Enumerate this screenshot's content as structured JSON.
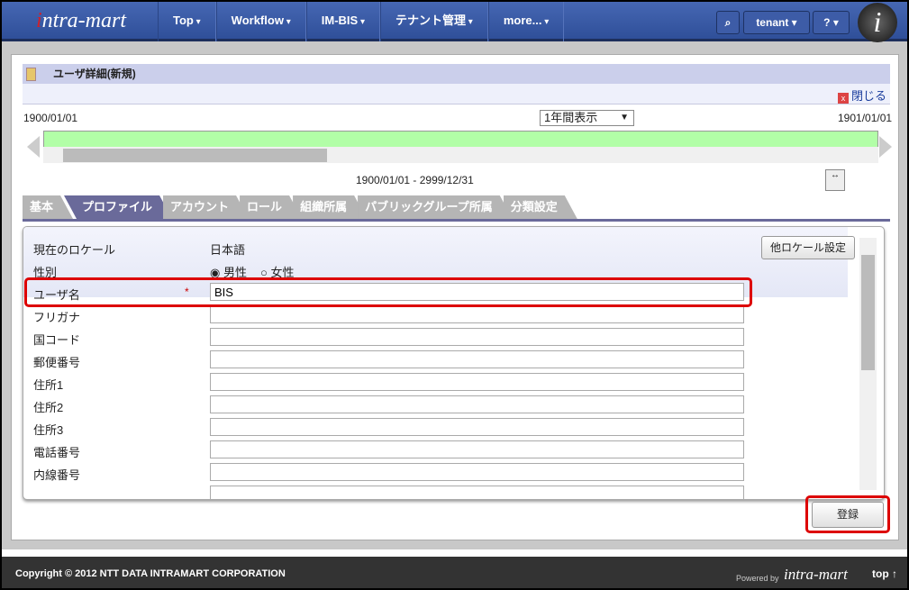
{
  "header": {
    "logo": "intra-mart",
    "nav": [
      "Top",
      "Workflow",
      "IM-BIS",
      "テナント管理",
      "more..."
    ],
    "user": "tenant",
    "help": "?"
  },
  "page": {
    "title": "ユーザ詳細(新規)",
    "close": "閉じる",
    "start_date": "1900/01/01",
    "end_date": "1901/01/01",
    "period_select": "1年間表示",
    "range": "1900/01/01 - 2999/12/31"
  },
  "tabs": [
    "基本",
    "プロファイル",
    "アカウント",
    "ロール",
    "組織所属",
    "パブリックグループ所属",
    "分類設定"
  ],
  "active_tab": "プロファイル",
  "form": {
    "locale_label": "現在のロケール",
    "locale_value": "日本語",
    "locale_button": "他ロケール設定",
    "gender_label": "性別",
    "gender_options": [
      "男性",
      "女性"
    ],
    "gender_selected": "男性",
    "required_mark": "*",
    "fields": [
      {
        "label": "ユーザ名",
        "value": "BIS"
      },
      {
        "label": "フリガナ",
        "value": ""
      },
      {
        "label": "国コード",
        "value": ""
      },
      {
        "label": "郵便番号",
        "value": ""
      },
      {
        "label": "住所1",
        "value": ""
      },
      {
        "label": "住所2",
        "value": ""
      },
      {
        "label": "住所3",
        "value": ""
      },
      {
        "label": "電話番号",
        "value": ""
      },
      {
        "label": "内線番号",
        "value": ""
      }
    ]
  },
  "register_button": "登録",
  "footer": {
    "copyright": "Copyright © 2012 NTT DATA INTRAMART CORPORATION",
    "powered_by": "Powered by",
    "powered_logo": "intra-mart",
    "top_link": "top ↑"
  }
}
